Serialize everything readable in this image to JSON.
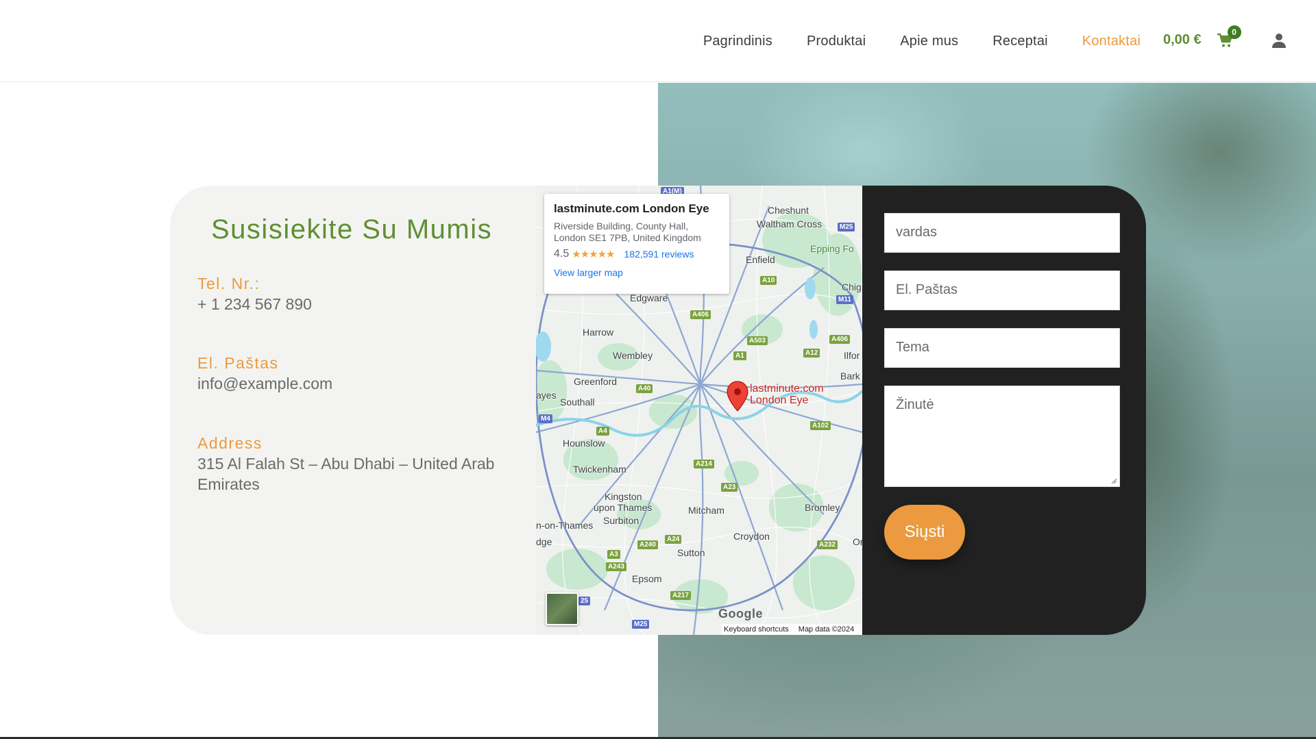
{
  "nav": {
    "items": [
      {
        "label": "Pagrindinis"
      },
      {
        "label": "Produktai"
      },
      {
        "label": "Apie mus"
      },
      {
        "label": "Receptai"
      },
      {
        "label": "Kontaktai"
      }
    ],
    "active": "Kontaktai",
    "active_color": "#eb9a3f"
  },
  "cart": {
    "total": "0,00 €",
    "count": "0",
    "icon": "shopping-cart-icon"
  },
  "account": {
    "icon": "user-icon"
  },
  "contact": {
    "title": "Susisiekite Su Mumis",
    "phone_label": "Tel. Nr.:",
    "phone": "+ 1 234 567 890",
    "email_label": "El. Paštas",
    "email": "info@example.com",
    "address_label": "Address",
    "address": "315 Al Falah St – Abu Dhabi – United Arab Emirates"
  },
  "map": {
    "place_title": "lastminute.com London Eye",
    "place_address": "Riverside Building, County Hall, London SE1 7PB, United Kingdom",
    "rating": "4.5",
    "stars": "★★★★★",
    "reviews": "182,591 reviews",
    "larger_map": "View larger map",
    "pin_label_1": "lastminute.com",
    "pin_label_2": "London Eye",
    "google": "Google",
    "shortcuts": "Keyboard shortcuts",
    "attribution": "Map data ©2024",
    "places": {
      "cheshunt": "Cheshunt",
      "waltham": "Waltham Cross",
      "epping": "Epping Fo",
      "enfield": "Enfield",
      "edgware": "Edgware",
      "chig": "Chig",
      "harrow": "Harrow",
      "wembley": "Wembley",
      "ilfor": "Ilfor",
      "bark": "Bark",
      "greenford": "Greenford",
      "southall": "Southall",
      "ayes": "ayes",
      "hounslow": "Hounslow",
      "twickenham": "Twickenham",
      "kingston": "Kingston",
      "upon": "upon Thames",
      "surbiton": "Surbiton",
      "onthames": "n-on-Thames",
      "mitcham": "Mitcham",
      "bromley": "Bromley",
      "croydon": "Croydon",
      "sutton": "Sutton",
      "epsom": "Epsom",
      "dge": "dge",
      "or": "Or"
    },
    "roads": {
      "a1m": "A1(M)",
      "m25a": "M25",
      "a10": "A10",
      "m11": "M11",
      "a406a": "A406",
      "a406b": "A406",
      "a503": "A503",
      "a12": "A12",
      "a1": "A1",
      "a40": "A40",
      "m4": "M4",
      "a4": "A4",
      "a102": "A102",
      "a214": "A214",
      "a23": "A23",
      "a24": "A24",
      "a240": "A240",
      "a3": "A3",
      "a243": "A243",
      "a217": "A217",
      "a232": "A232",
      "m25b": "M25",
      "r25": "25"
    }
  },
  "form": {
    "name_placeholder": "vardas",
    "email_placeholder": "El. Paštas",
    "subject_placeholder": "Tema",
    "message_placeholder": "Žinutė",
    "submit": "Siųsti"
  }
}
